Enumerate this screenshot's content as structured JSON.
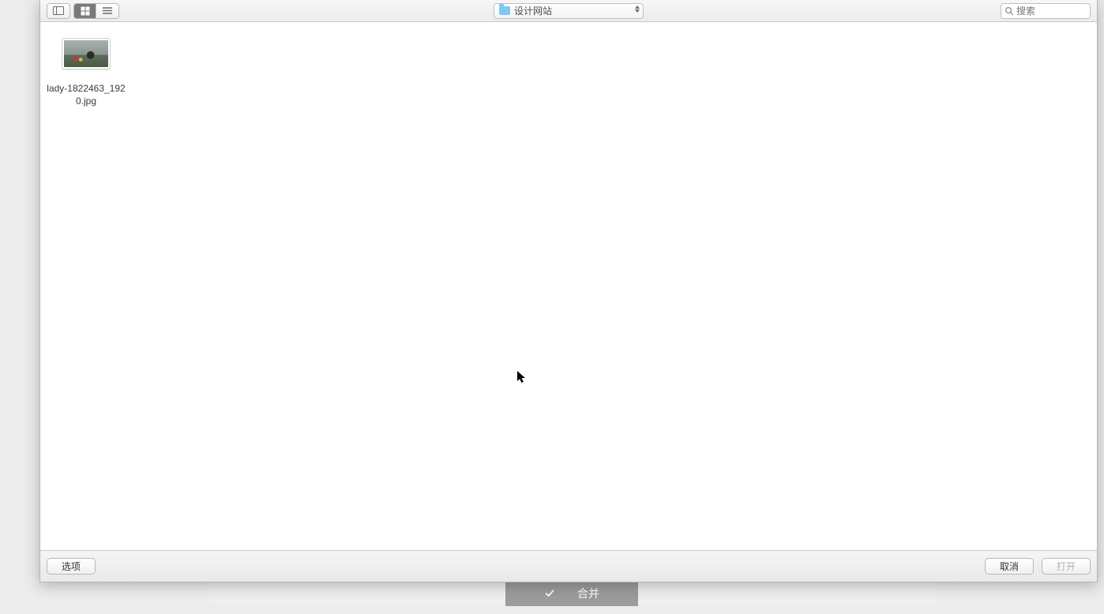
{
  "toolbar": {
    "folder_name": "设计网站",
    "search_placeholder": "搜索"
  },
  "files": [
    {
      "name": "lady-1822463_1920.jpg"
    }
  ],
  "footer": {
    "options_label": "选项",
    "cancel_label": "取消",
    "open_label": "打开"
  },
  "background_button": {
    "label": "合并"
  }
}
